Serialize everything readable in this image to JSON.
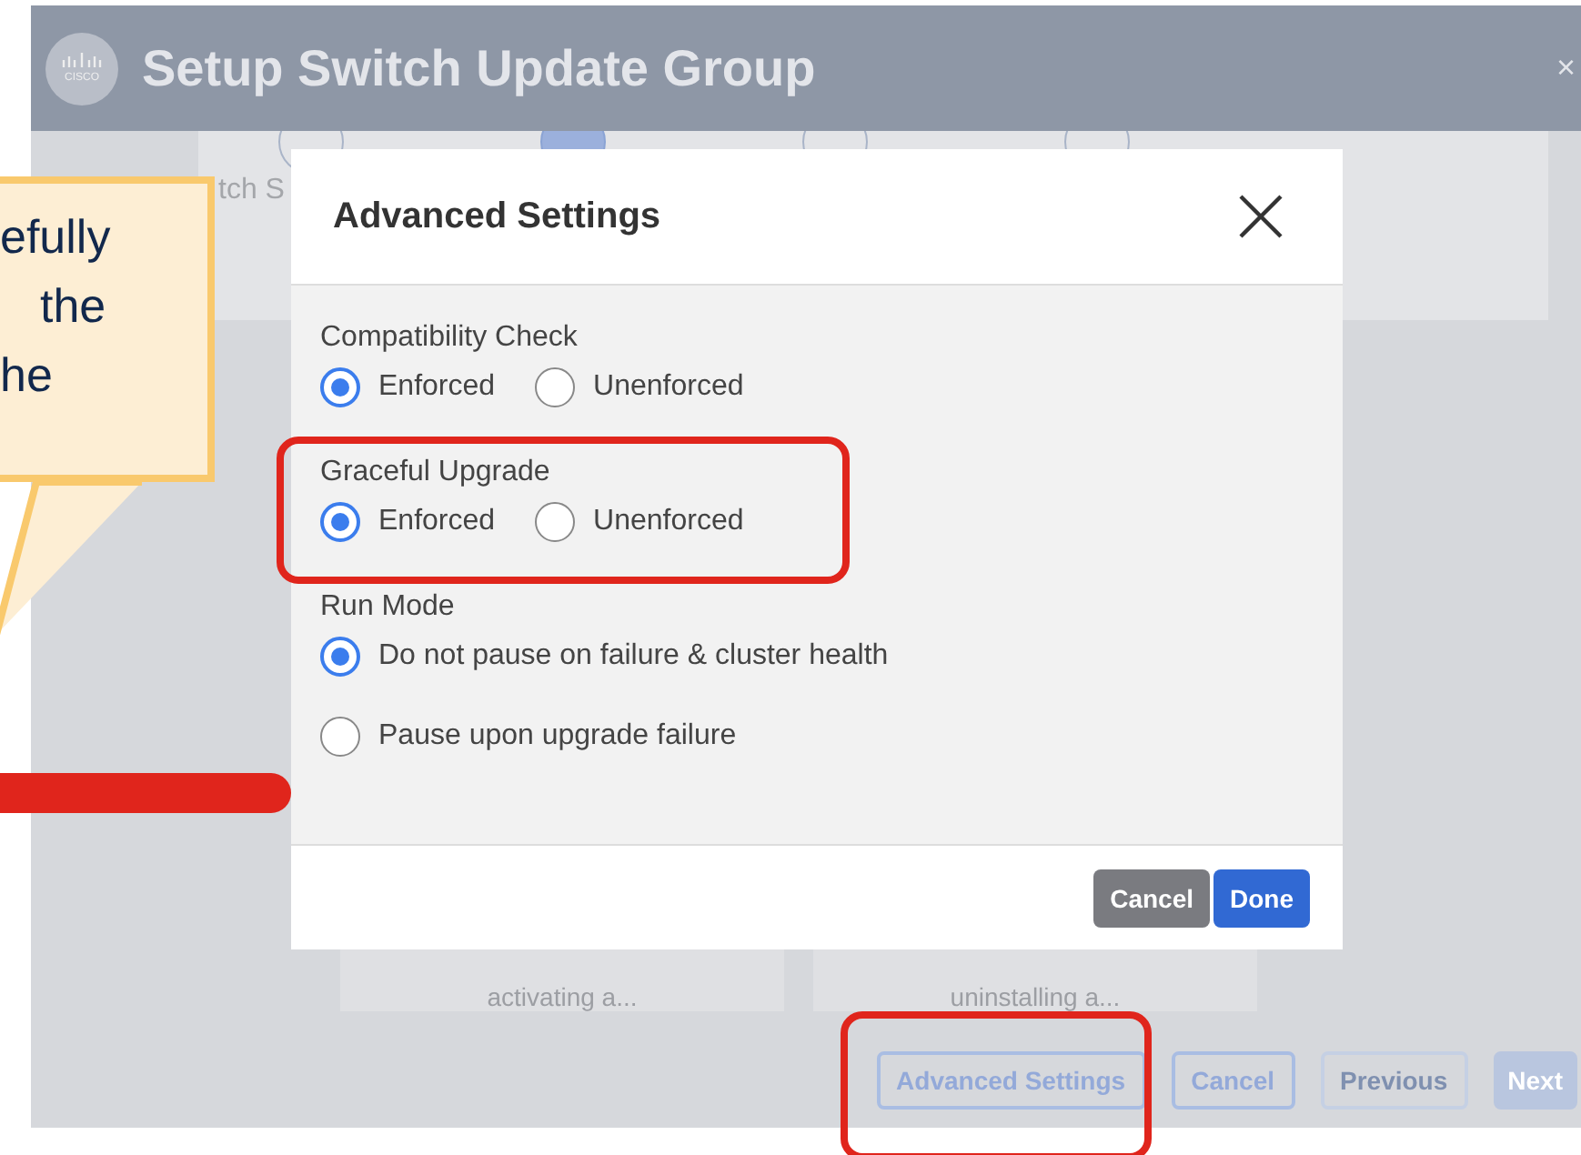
{
  "window": {
    "title": "Setup Switch Update Group",
    "logo_text": "CISCO",
    "close": "×"
  },
  "wizard": {
    "steps": [
      {
        "selected": false
      },
      {
        "selected": true
      },
      {
        "selected": false
      },
      {
        "selected": false
      }
    ],
    "step_label": "tch S",
    "cards": [
      {
        "text": "activating a..."
      },
      {
        "text": "uninstalling a..."
      }
    ],
    "buttons": [
      {
        "label": "Advanced Settings",
        "kind": "outline"
      },
      {
        "label": "Cancel",
        "kind": "outline"
      },
      {
        "label": "Previous",
        "kind": "disabled"
      },
      {
        "label": "Next",
        "kind": "filled-disabled"
      }
    ]
  },
  "modal": {
    "title": "Advanced Settings",
    "groups": [
      {
        "label": "Compatibility Check",
        "kind": "inline",
        "options": [
          {
            "label": "Enforced",
            "selected": true
          },
          {
            "label": "Unenforced",
            "selected": false
          }
        ]
      },
      {
        "label": "Graceful Upgrade",
        "kind": "inline",
        "options": [
          {
            "label": "Enforced",
            "selected": true
          },
          {
            "label": "Unenforced",
            "selected": false
          }
        ]
      },
      {
        "label": "Run Mode",
        "kind": "stacked",
        "options": [
          {
            "label": "Do not pause on failure & cluster health",
            "selected": true
          },
          {
            "label": "Pause upon upgrade failure",
            "selected": false
          }
        ]
      }
    ],
    "buttons": [
      {
        "label": "Cancel",
        "kind": "secondary"
      },
      {
        "label": "Done",
        "kind": "primary"
      }
    ]
  },
  "callout": {
    "lines": [
      "efully",
      "the",
      "he"
    ]
  }
}
